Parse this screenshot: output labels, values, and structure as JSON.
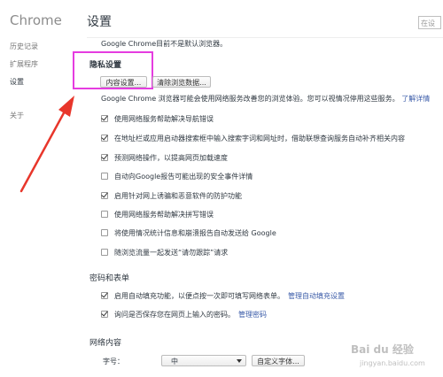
{
  "sidebar": {
    "brand": "Chrome",
    "items": [
      {
        "label": "历史记录"
      },
      {
        "label": "扩展程序"
      },
      {
        "label": "设置"
      },
      {
        "label": "关于"
      }
    ]
  },
  "header": {
    "title": "设置",
    "search_placeholder": "在设"
  },
  "default_browser_text": "Google Chrome目前不是默认浏览器。",
  "privacy": {
    "title": "隐私设置",
    "content_settings_button": "内容设置...",
    "clear_data_button": "清除浏览数据...",
    "description": "Google Chrome 浏览器可能会使用网络服务改善您的浏览体验。您可以视情况停用这些服务。",
    "learn_more": "了解详情",
    "options": [
      {
        "label": "使用网络服务帮助解决导航错误",
        "checked": true
      },
      {
        "label": "在地址栏或应用启动器搜索框中输入搜索字词和网址时，借助联想查询服务自动补齐相关内容",
        "checked": true
      },
      {
        "label": "预测网络操作，以提高网页加载速度",
        "checked": true
      },
      {
        "label": "自动向Google报告可能出现的安全事件详情",
        "checked": false
      },
      {
        "label": "启用针对网上诱骗和恶意软件的防护功能",
        "checked": true
      },
      {
        "label": "使用网络服务帮助解决拼写错误",
        "checked": false
      },
      {
        "label": "将使用情况统计信息和崩溃报告自动发送给 Google",
        "checked": false
      },
      {
        "label": "随浏览流量一起发送“请勿跟踪”请求",
        "checked": false
      }
    ]
  },
  "passwords": {
    "title": "密码和表单",
    "autofill_label": "启用自动填充功能，以便点按一次即可填写网络表单。",
    "autofill_link": "管理自动填充设置",
    "save_password_label": "询问是否保存您在网页上输入的密码。",
    "save_password_link": "管理密码"
  },
  "web_content": {
    "title": "网络内容",
    "font_size_label": "字号：",
    "font_size_value": "中",
    "custom_fonts_button": "自定义字体..."
  },
  "colors": {
    "highlight": "#e53ce0",
    "arrow": "#e8362b",
    "link": "#3a5ba8"
  },
  "watermark": {
    "text": "Bai du 经验",
    "url": "jingyan.baidu.com"
  }
}
